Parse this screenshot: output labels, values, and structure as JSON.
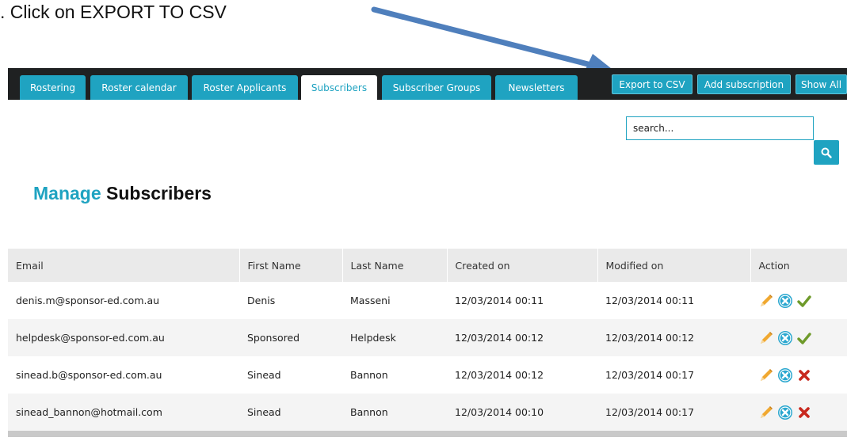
{
  "instruction": ". Click on EXPORT TO CSV",
  "tabs": [
    {
      "label": "Rostering",
      "active": false
    },
    {
      "label": "Roster calendar",
      "active": false
    },
    {
      "label": "Roster Applicants",
      "active": false
    },
    {
      "label": "Subscribers",
      "active": true
    },
    {
      "label": "Subscriber Groups",
      "active": false
    },
    {
      "label": "Newsletters",
      "active": false
    }
  ],
  "toolbar": {
    "export_label": "Export to CSV",
    "add_label": "Add subscription",
    "show_all_label": "Show All"
  },
  "search": {
    "placeholder": "search...",
    "icon": "search-icon"
  },
  "page_title": {
    "accent": "Manage",
    "rest": "Subscribers"
  },
  "table": {
    "columns": [
      "Email",
      "First Name",
      "Last Name",
      "Created on",
      "Modified on",
      "Action"
    ],
    "rows": [
      {
        "email": "denis.m@sponsor-ed.com.au",
        "first": "Denis",
        "last": "Masseni",
        "created": "12/03/2014 00:11",
        "modified": "12/03/2014 00:11",
        "status": "active"
      },
      {
        "email": "helpdesk@sponsor-ed.com.au",
        "first": "Sponsored",
        "last": "Helpdesk",
        "created": "12/03/2014 00:12",
        "modified": "12/03/2014 00:12",
        "status": "active"
      },
      {
        "email": "sinead.b@sponsor-ed.com.au",
        "first": "Sinead",
        "last": "Bannon",
        "created": "12/03/2014 00:12",
        "modified": "12/03/2014 00:17",
        "status": "inactive"
      },
      {
        "email": "sinead_bannon@hotmail.com",
        "first": "Sinead",
        "last": "Bannon",
        "created": "12/03/2014 00:10",
        "modified": "12/03/2014 00:17",
        "status": "inactive"
      }
    ]
  },
  "colors": {
    "accent": "#1fa3c1",
    "topbar": "#1f2122",
    "arrow": "#4f7fbc",
    "pencil": "#f0a830",
    "check": "#6e9a2a",
    "cross": "#c8281e"
  }
}
